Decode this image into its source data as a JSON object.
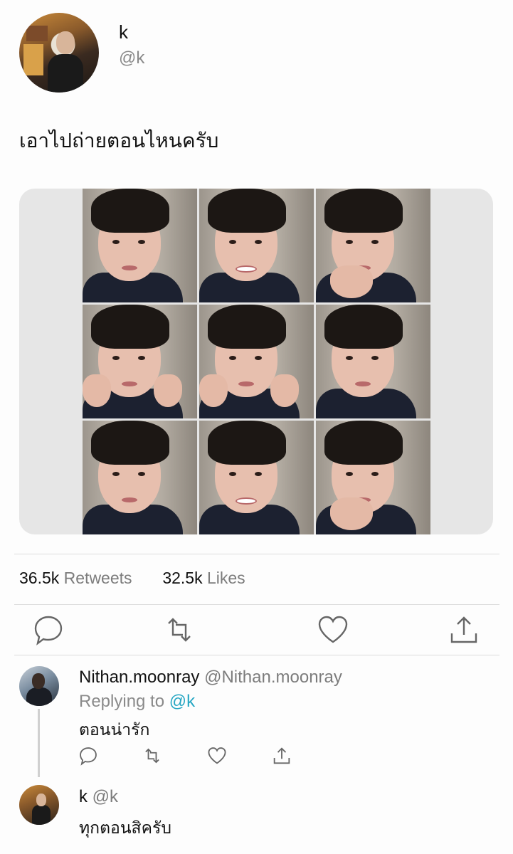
{
  "tweet": {
    "author_name": "k",
    "author_handle": "@k",
    "text": "เอาไปถ่ายตอนไหนครับ",
    "retweets_count": "36.5k",
    "retweets_label": "Retweets",
    "likes_count": "32.5k",
    "likes_label": "Likes"
  },
  "actions": [
    "reply-icon",
    "retweet-icon",
    "like-icon",
    "share-icon"
  ],
  "reply": {
    "display_name": "Nithan.moonray",
    "handle": "@Nithan.moonray",
    "replying_label": "Replying to",
    "replying_handle": "@k",
    "text": "ตอนน่ารัก"
  },
  "reply2": {
    "display_name": "k",
    "handle": "@k",
    "text": "ทุกตอนสิครับ"
  },
  "colors": {
    "link": "#27a7c3",
    "muted": "#7c7c7c",
    "background": "#fdfdfd"
  }
}
